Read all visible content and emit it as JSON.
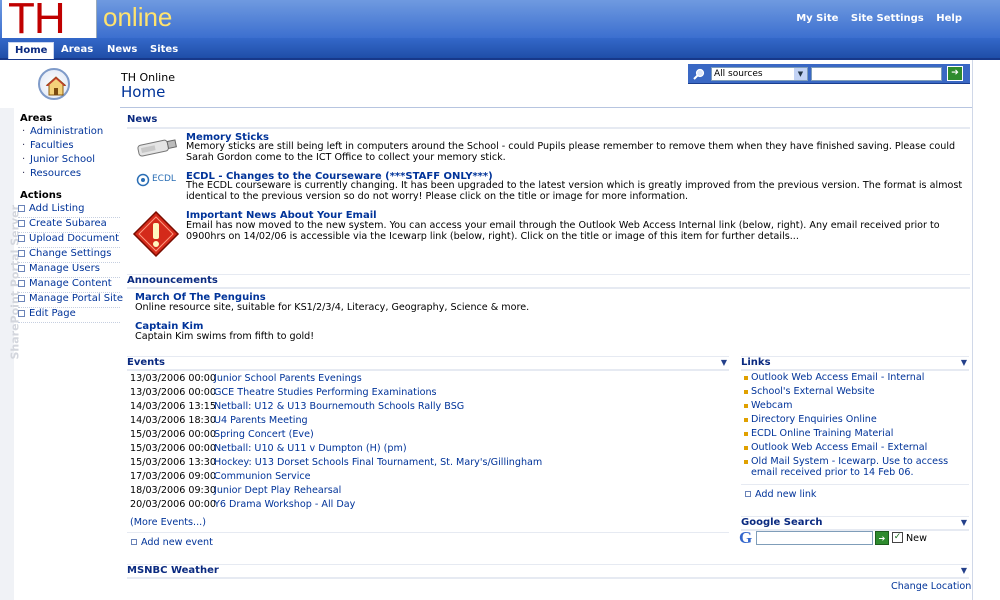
{
  "header": {
    "logo_th": "TH",
    "logo_online": "online",
    "links": [
      "My Site",
      "Site Settings",
      "Help"
    ]
  },
  "tabs": [
    "Home",
    "Areas",
    "News",
    "Sites"
  ],
  "sidebar": {
    "watermark": "SharePoint Portal Server",
    "areas_title": "Areas",
    "areas": [
      "Administration",
      "Faculties",
      "Junior School",
      "Resources"
    ],
    "actions_title": "Actions",
    "actions": [
      "Add Listing",
      "Create Subarea",
      "Upload Document",
      "Change Settings",
      "Manage Users",
      "Manage Content",
      "Manage Portal Site",
      "Edit Page"
    ]
  },
  "page": {
    "site_name": "TH Online",
    "title": "Home"
  },
  "search": {
    "scope": "All sources",
    "query": ""
  },
  "news": {
    "title": "News",
    "items": [
      {
        "title": "Memory Sticks",
        "body": "Memory sticks are still being left in computers around the School - could Pupils please remember to remove them when they have finished saving. Please could Sarah Gordon come to the ICT Office to collect your memory stick."
      },
      {
        "title": "ECDL - Changes to the Courseware (***STAFF ONLY***)",
        "body": "The ECDL courseware is currently changing. It has been upgraded to the latest version which is greatly improved from the previous version. The format is almost identical to the previous version so do not worry! Please click on the title or image for more information."
      },
      {
        "title": "Important News About Your Email",
        "body": "Email has now moved to the new system. You can access your email through the Outlook Web Access Internal link (below, right). Any email received prior to 0900hrs on 14/02/06 is accessible via the Icewarp link (below, right). Click on the title or image of this item for further details..."
      }
    ],
    "ecdl_logo": "ECDL"
  },
  "announcements": {
    "title": "Announcements",
    "items": [
      {
        "title": "March Of The Penguins",
        "body": "Online resource site, suitable for KS1/2/3/4, Literacy, Geography, Science & more."
      },
      {
        "title": "Captain Kim",
        "body": "Captain Kim swims from fifth to gold!"
      }
    ]
  },
  "events": {
    "title": "Events",
    "items": [
      {
        "date": "13/03/2006 00:00",
        "title": "Junior School Parents Evenings"
      },
      {
        "date": "13/03/2006 00:00",
        "title": "GCE Theatre Studies Performing Examinations"
      },
      {
        "date": "14/03/2006 13:15",
        "title": "Netball: U12 & U13 Bournemouth Schools Rally BSG"
      },
      {
        "date": "14/03/2006 18:30",
        "title": "U4 Parents Meeting"
      },
      {
        "date": "15/03/2006 00:00",
        "title": "Spring Concert (Eve)"
      },
      {
        "date": "15/03/2006 00:00",
        "title": "Netball: U10 & U11 v Dumpton (H) (pm)"
      },
      {
        "date": "15/03/2006 13:30",
        "title": "Hockey: U13 Dorset Schools Final Tournament, St. Mary's/Gillingham"
      },
      {
        "date": "17/03/2006 09:00",
        "title": "Communion Service"
      },
      {
        "date": "18/03/2006 09:30",
        "title": "Junior Dept Play Rehearsal"
      },
      {
        "date": "20/03/2006 00:00",
        "title": "Y6 Drama Workshop - All Day"
      }
    ],
    "more": "(More Events...)",
    "add": "Add new event"
  },
  "links": {
    "title": "Links",
    "items": [
      "Outlook Web Access Email - Internal",
      "School's External Website",
      "Webcam",
      "Directory Enquiries Online",
      "ECDL Online Training Material",
      "Outlook Web Access Email - External",
      "Old Mail System - Icewarp. Use to access email received prior to 14 Feb 06."
    ],
    "add": "Add new link"
  },
  "google": {
    "title": "Google Search",
    "logo": "G",
    "query": "",
    "new_label": "New",
    "new_checked": true
  },
  "weather": {
    "title": "MSNBC Weather",
    "change": "Change Location"
  },
  "colors": {
    "banner": "#3c6fcf",
    "tabbar": "#1f4ea8",
    "link": "#003399",
    "logo_red": "#c00000",
    "logo_yellow": "#ffe36e"
  }
}
